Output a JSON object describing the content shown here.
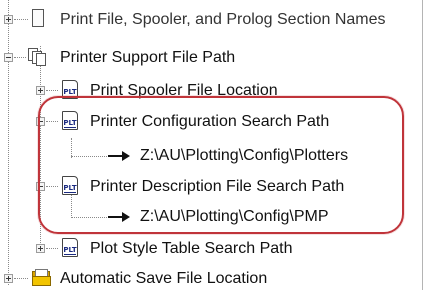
{
  "tree": {
    "rows": [
      {
        "label": "Print File, Spooler, and Prolog Section Names",
        "icon": "document-icon",
        "expanded": false
      },
      {
        "label": "Printer Support File Path",
        "icon": "multi-document-icon",
        "expanded": true
      },
      {
        "label": "Print Spooler File Location",
        "icon": "plt-file-icon",
        "expanded": false
      },
      {
        "label": "Printer Configuration Search Path",
        "icon": "plt-file-icon",
        "expanded": true
      },
      {
        "label": "Z:\\AU\\Plotting\\Config\\Plotters",
        "icon": "arrow-right-icon"
      },
      {
        "label": "Printer Description File Search Path",
        "icon": "plt-file-icon",
        "expanded": true
      },
      {
        "label": "Z:\\AU\\Plotting\\Config\\PMP",
        "icon": "arrow-right-icon"
      },
      {
        "label": "Plot Style Table Search Path",
        "icon": "plt-file-icon",
        "expanded": false
      },
      {
        "label": "Automatic Save File Location",
        "icon": "folder-icon",
        "expanded": false
      }
    ],
    "plt_icon_text": "PLT"
  },
  "highlight_color": "#c0343a"
}
